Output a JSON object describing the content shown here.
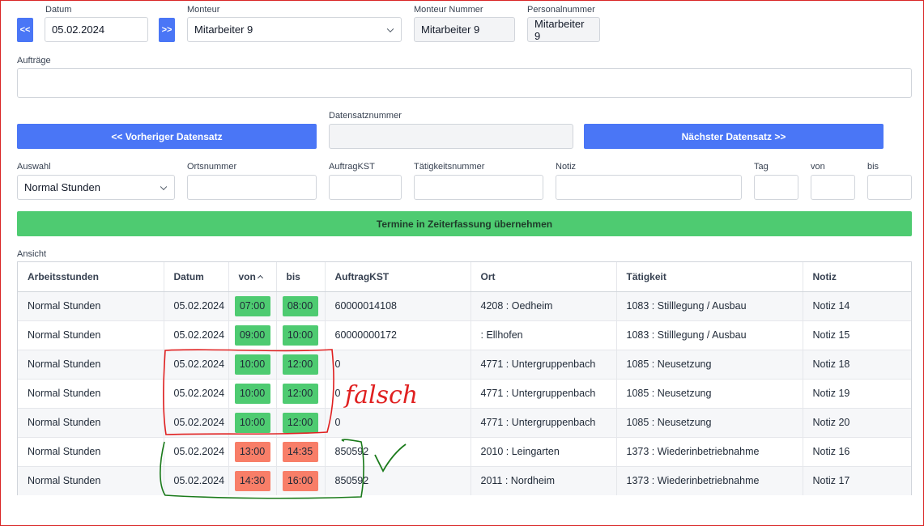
{
  "header": {
    "datum_label": "Datum",
    "datum_value": "05.02.2024",
    "prev_day": "<<",
    "next_day": ">>",
    "monteur_label": "Monteur",
    "monteur_value": "Mitarbeiter 9",
    "monteur_nummer_label": "Monteur Nummer",
    "monteur_nummer_value": "Mitarbeiter 9",
    "personalnummer_label": "Personalnummer",
    "personalnummer_value": "Mitarbeiter 9"
  },
  "auftraege": {
    "label": "Aufträge",
    "value": ""
  },
  "navigation": {
    "prev_record": "<< Vorheriger Datensatz",
    "next_record": "Nächster Datensatz >>",
    "datensatz_label": "Datensatznummer",
    "datensatz_value": ""
  },
  "form": {
    "auswahl_label": "Auswahl",
    "auswahl_value": "Normal Stunden",
    "ortsnummer_label": "Ortsnummer",
    "auftragkst_label": "AuftragKST",
    "taetigkeit_label": "Tätigkeitsnummer",
    "notiz_label": "Notiz",
    "tag_label": "Tag",
    "von_label": "von",
    "bis_label": "bis"
  },
  "submit_label": "Termine in Zeiterfassung übernehmen",
  "table": {
    "label": "Ansicht",
    "columns": [
      "Arbeitsstunden",
      "Datum",
      "von",
      "bis",
      "AuftragKST",
      "Ort",
      "Tätigkeit",
      "Notiz"
    ],
    "rows": [
      {
        "arbeitsstunden": "Normal Stunden",
        "datum": "05.02.2024",
        "von": "07:00",
        "bis": "08:00",
        "auftragkst": "60000014108",
        "ort": "4208 : Oedheim",
        "taetigkeit": "1083 : Stilllegung / Ausbau",
        "notiz": "Notiz 14",
        "status": "green"
      },
      {
        "arbeitsstunden": "Normal Stunden",
        "datum": "05.02.2024",
        "von": "09:00",
        "bis": "10:00",
        "auftragkst": "60000000172",
        "ort": ": Ellhofen",
        "taetigkeit": "1083 : Stilllegung / Ausbau",
        "notiz": "Notiz 15",
        "status": "green"
      },
      {
        "arbeitsstunden": "Normal Stunden",
        "datum": "05.02.2024",
        "von": "10:00",
        "bis": "12:00",
        "auftragkst": "0",
        "ort": "4771 : Untergruppenbach",
        "taetigkeit": "1085 : Neusetzung",
        "notiz": "Notiz 18",
        "status": "green"
      },
      {
        "arbeitsstunden": "Normal Stunden",
        "datum": "05.02.2024",
        "von": "10:00",
        "bis": "12:00",
        "auftragkst": "0",
        "ort": "4771 : Untergruppenbach",
        "taetigkeit": "1085 : Neusetzung",
        "notiz": "Notiz 19",
        "status": "green"
      },
      {
        "arbeitsstunden": "Normal Stunden",
        "datum": "05.02.2024",
        "von": "10:00",
        "bis": "12:00",
        "auftragkst": "0",
        "ort": "4771 : Untergruppenbach",
        "taetigkeit": "1085 : Neusetzung",
        "notiz": "Notiz 20",
        "status": "green"
      },
      {
        "arbeitsstunden": "Normal Stunden",
        "datum": "05.02.2024",
        "von": "13:00",
        "bis": "14:35",
        "auftragkst": "850592",
        "ort": "2010 : Leingarten",
        "taetigkeit": "1373 : Wiederinbetriebnahme",
        "notiz": "Notiz 16",
        "status": "red"
      },
      {
        "arbeitsstunden": "Normal Stunden",
        "datum": "05.02.2024",
        "von": "14:30",
        "bis": "16:00",
        "auftragkst": "850592",
        "ort": "2011 : Nordheim",
        "taetigkeit": "1373 : Wiederinbetriebnahme",
        "notiz": "Notiz 17",
        "status": "red"
      }
    ]
  },
  "annotations": {
    "handwritten_text": "falsch",
    "check_mark": "✓"
  },
  "colors": {
    "primary": "#4a76f6",
    "success": "#4ecb71",
    "danger": "#f87e68",
    "annotation_red": "#e02020",
    "annotation_green": "#1a7a1a"
  }
}
